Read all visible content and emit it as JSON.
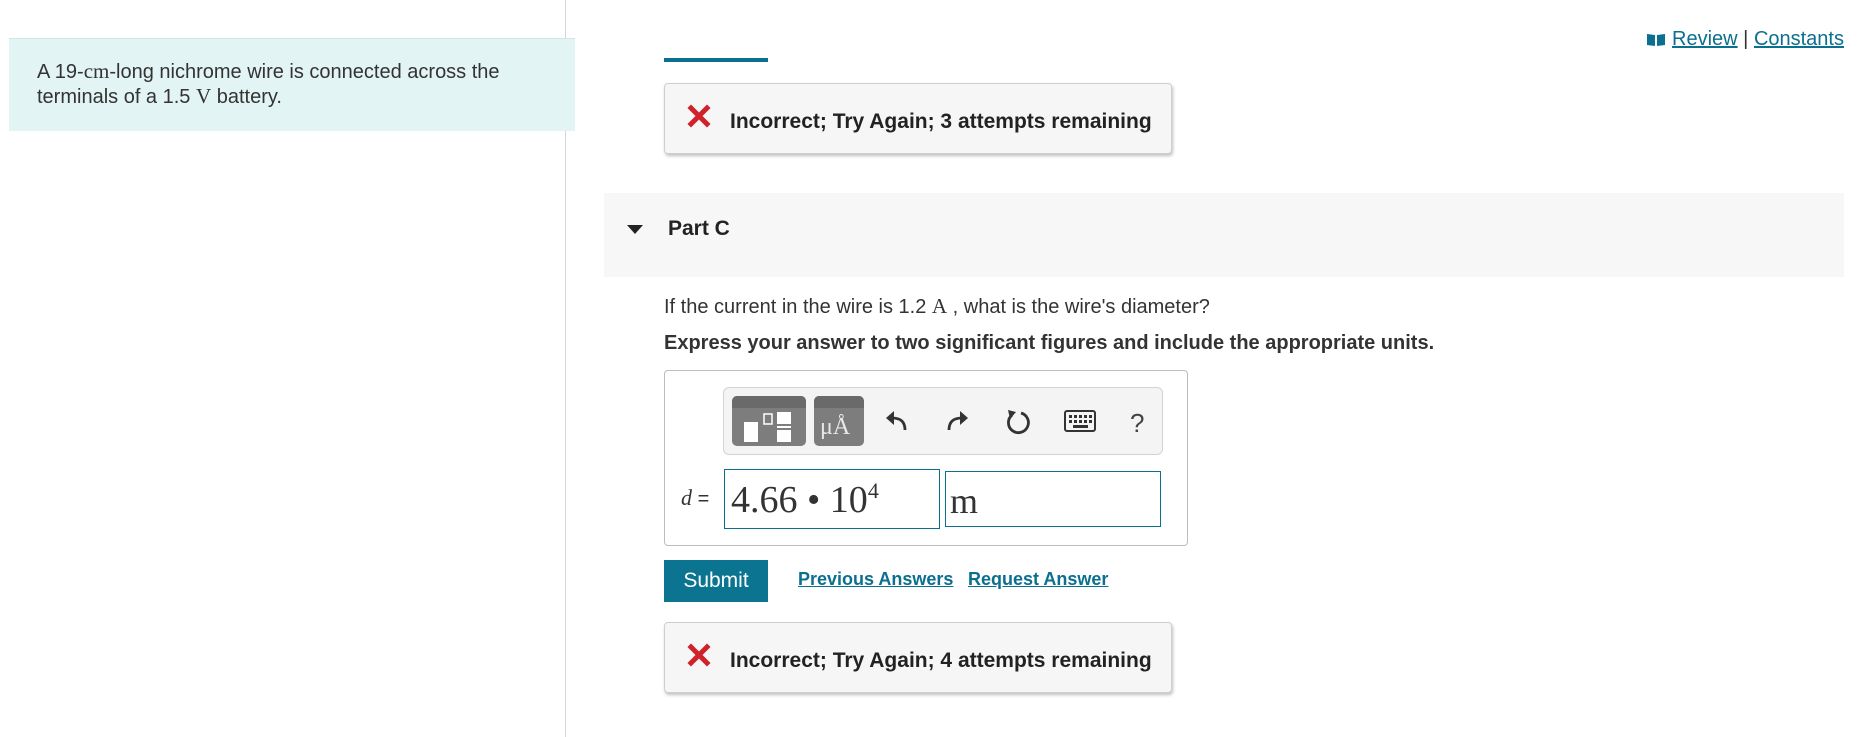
{
  "intro": {
    "text_before": "A 19-",
    "length_unit": "cm",
    "text_middle": "-long nichrome wire is connected across the terminals of a 1.5",
    "voltage_unit": "V",
    "text_after": "battery."
  },
  "top_links": {
    "review": "Review",
    "separator": "|",
    "constants": "Constants"
  },
  "feedback_top": {
    "message": "Incorrect; Try Again; 3 attempts remaining"
  },
  "part": {
    "title": "Part C"
  },
  "question": {
    "text_before": "If the current in the wire is 1.2",
    "current_unit": "A",
    "text_after": ", what is the wire's diameter?",
    "instruction": "Express your answer to two significant figures and include the appropriate units."
  },
  "toolbar": {
    "unit_glyph": "μÅ",
    "help": "?"
  },
  "answer": {
    "variable": "d",
    "equals": "=",
    "value_mantissa": "4.66 • 10",
    "value_exponent": "4",
    "unit": "m"
  },
  "actions": {
    "submit": "Submit",
    "previous_answers": "Previous Answers",
    "request_answer": "Request Answer"
  },
  "feedback_bottom": {
    "message": "Incorrect; Try Again; 4 attempts remaining"
  },
  "colors": {
    "accent": "#0b6f8f",
    "error": "#d0222b",
    "intro_bg": "#e3f4f4",
    "submit_bg": "#0b7490"
  }
}
